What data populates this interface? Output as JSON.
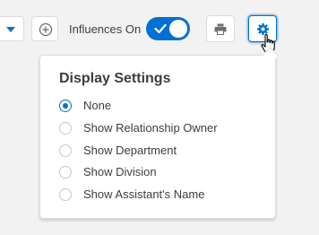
{
  "toolbar": {
    "dropdown_icon": "chevron-down-icon",
    "add_icon": "add-circle-icon",
    "toggle_label": "Influences On",
    "toggle_state": "on",
    "print_icon": "print-icon",
    "settings_icon": "gear-icon"
  },
  "popover": {
    "title": "Display Settings",
    "options": [
      {
        "label": "None",
        "checked": true
      },
      {
        "label": "Show Relationship Owner",
        "checked": false
      },
      {
        "label": "Show Department",
        "checked": false
      },
      {
        "label": "Show Division",
        "checked": false
      },
      {
        "label": "Show Assistant's Name",
        "checked": false
      }
    ]
  },
  "colors": {
    "accent": "#0070d2",
    "text": "#3e3e3c",
    "border": "#dddbda",
    "background": "#f3f2f2"
  }
}
